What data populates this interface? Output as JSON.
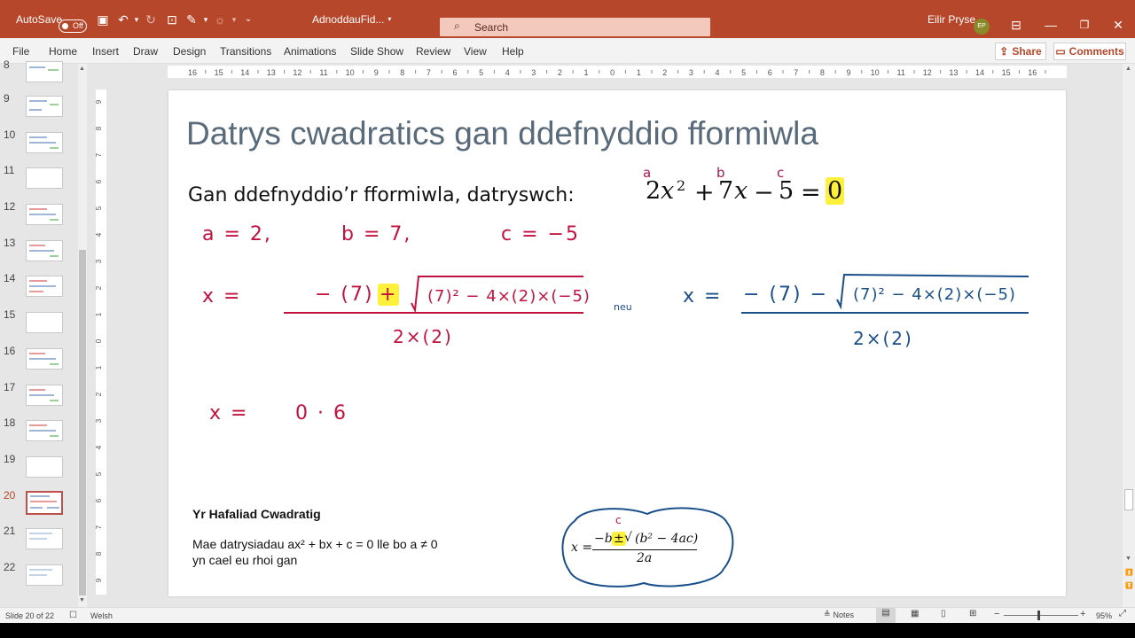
{
  "titlebar": {
    "autosave_label": "AutoSave",
    "autosave_state": "Off",
    "filename": "AdnoddauFid...",
    "search_placeholder": "Search",
    "user_name": "Eilir Pryse",
    "user_initials": "EP"
  },
  "ribbon": {
    "tabs": [
      "File",
      "Home",
      "Insert",
      "Draw",
      "Design",
      "Transitions",
      "Animations",
      "Slide Show",
      "Review",
      "View",
      "Help"
    ],
    "share_label": "Share",
    "comments_label": "Comments"
  },
  "thumbnails": {
    "numbers": [
      "8",
      "9",
      "10",
      "11",
      "12",
      "13",
      "14",
      "15",
      "16",
      "17",
      "18",
      "19",
      "20",
      "21",
      "22"
    ],
    "active": "20"
  },
  "ruler": {
    "h_ticks": [
      "16",
      "15",
      "14",
      "13",
      "12",
      "11",
      "10",
      "9",
      "8",
      "7",
      "6",
      "5",
      "4",
      "3",
      "2",
      "1",
      "0",
      "1",
      "2",
      "3",
      "4",
      "5",
      "6",
      "7",
      "8",
      "9",
      "10",
      "11",
      "12",
      "13",
      "14",
      "15",
      "16"
    ],
    "v_ticks": [
      "9",
      "8",
      "7",
      "6",
      "5",
      "4",
      "3",
      "2",
      "1",
      "0",
      "1",
      "2",
      "3",
      "4",
      "5",
      "6",
      "7",
      "8",
      "9"
    ]
  },
  "slide": {
    "title": "Datrys cwadratics gan ddefnyddio fformiwla",
    "intro": "Gan ddefnyddio’r fformiwla, datryswch:",
    "equation": {
      "coef_a": "2",
      "x2": "x",
      "sup2": "2",
      "plus": "+",
      "coef_b": "7",
      "x": "x",
      "minus": "−",
      "coef_c": "5",
      "equals": "=",
      "rhs": "0",
      "label_a": "a",
      "label_b": "b",
      "label_c": "c"
    },
    "handwriting": {
      "a_value": "a = 2,",
      "b_value": "b = 7,",
      "c_value": "c = −5",
      "x_eq": "x =",
      "red_numerator_start": "− (7)",
      "red_plus": "+",
      "red_sqrt_content": "(7)² − 4×(2)×(−5)",
      "red_denominator": "2×(2)",
      "or_word": "neu",
      "blue_x_eq": "x =",
      "blue_numerator": "− (7) −",
      "blue_sqrt_content": "(7)² − 4×(2)×(−5)",
      "blue_denominator": "2×(2)",
      "result_x": "x =",
      "result_value": "0 · 6"
    },
    "info_box": {
      "heading": "Yr Hafaliad Cwadratig",
      "line1": "Mae datrysiadau ax² + bx + c = 0 lle bo a ≠ 0",
      "line2": "yn cael eu rhoi gan",
      "formula_x": "x =",
      "formula_num_minus_b": "−b",
      "formula_pm": "±",
      "formula_sqrt": "(b² − 4ac)",
      "formula_den": "2a",
      "formula_mark": "c"
    }
  },
  "statusbar": {
    "slide_count": "Slide 20 of 22",
    "language": "Welsh",
    "notes_label": "Notes",
    "zoom": "95%"
  }
}
